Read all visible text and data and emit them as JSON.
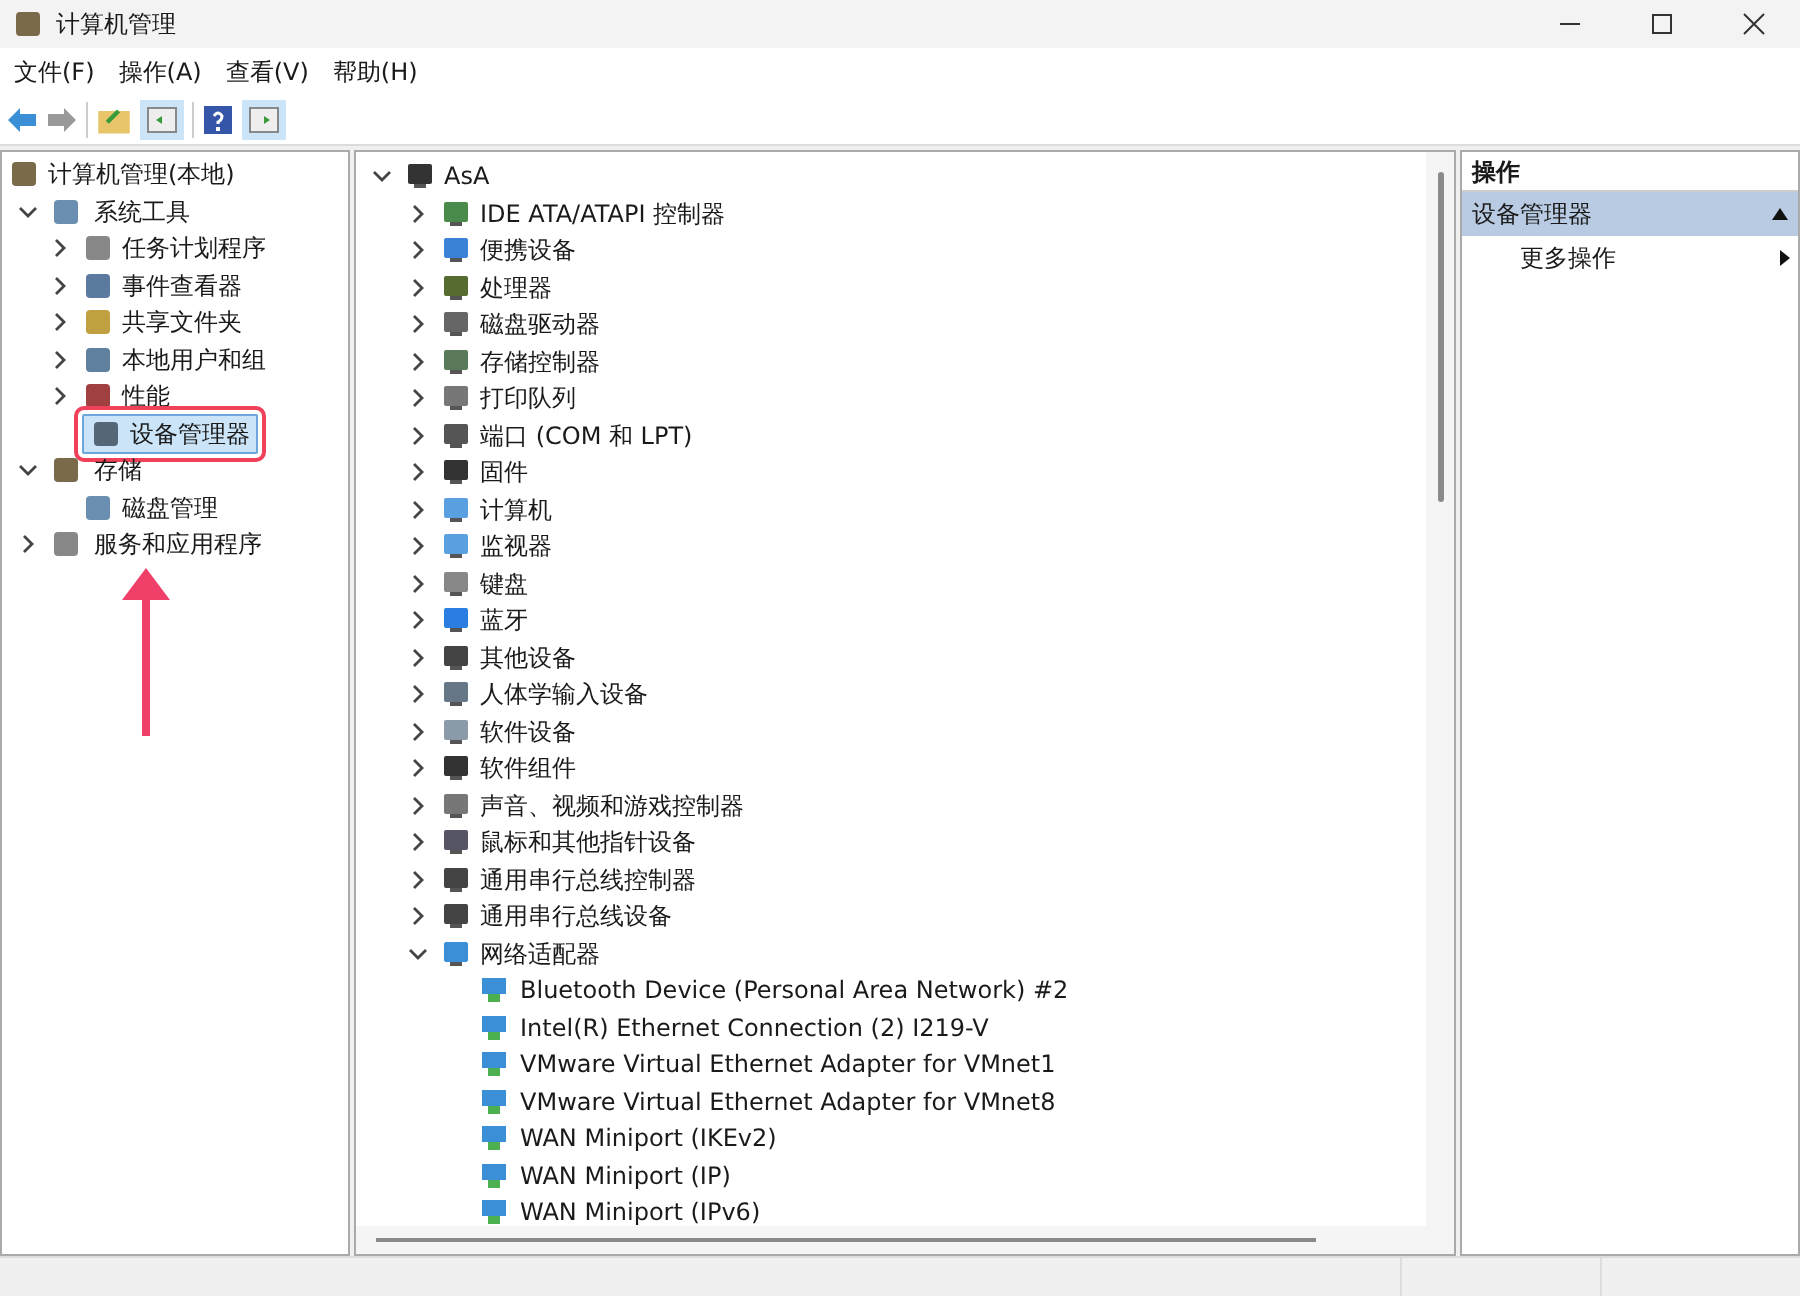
{
  "window": {
    "title": "计算机管理"
  },
  "menu": [
    "文件(F)",
    "操作(A)",
    "查看(V)",
    "帮助(H)"
  ],
  "left_tree": {
    "label": "计算机管理(本地)",
    "children": [
      {
        "label": "系统工具",
        "expanded": true,
        "selected": false,
        "children": [
          {
            "label": "任务计划程序",
            "expanded": false,
            "selected": false
          },
          {
            "label": "事件查看器",
            "expanded": false,
            "selected": false
          },
          {
            "label": "共享文件夹",
            "expanded": false,
            "selected": false
          },
          {
            "label": "本地用户和组",
            "expanded": false,
            "selected": false
          },
          {
            "label": "性能",
            "expanded": false,
            "selected": false
          },
          {
            "label": "设备管理器",
            "selected": true
          }
        ]
      },
      {
        "label": "存储",
        "expanded": true,
        "selected": false,
        "children": [
          {
            "label": "磁盘管理",
            "selected": false
          }
        ]
      },
      {
        "label": "服务和应用程序",
        "expanded": false,
        "selected": false
      }
    ]
  },
  "device_tree": {
    "label": "AsA",
    "expanded": true,
    "children": [
      {
        "label": "IDE ATA/ATAPI 控制器",
        "expanded": false
      },
      {
        "label": "便携设备",
        "expanded": false
      },
      {
        "label": "处理器",
        "expanded": false
      },
      {
        "label": "磁盘驱动器",
        "expanded": false
      },
      {
        "label": "存储控制器",
        "expanded": false
      },
      {
        "label": "打印队列",
        "expanded": false
      },
      {
        "label": "端口 (COM 和 LPT)",
        "expanded": false
      },
      {
        "label": "固件",
        "expanded": false
      },
      {
        "label": "计算机",
        "expanded": false
      },
      {
        "label": "监视器",
        "expanded": false
      },
      {
        "label": "键盘",
        "expanded": false
      },
      {
        "label": "蓝牙",
        "expanded": false
      },
      {
        "label": "其他设备",
        "expanded": false
      },
      {
        "label": "人体学输入设备",
        "expanded": false
      },
      {
        "label": "软件设备",
        "expanded": false
      },
      {
        "label": "软件组件",
        "expanded": false
      },
      {
        "label": "声音、视频和游戏控制器",
        "expanded": false
      },
      {
        "label": "鼠标和其他指针设备",
        "expanded": false
      },
      {
        "label": "通用串行总线控制器",
        "expanded": false
      },
      {
        "label": "通用串行总线设备",
        "expanded": false
      },
      {
        "label": "网络适配器",
        "expanded": true,
        "children": [
          {
            "label": "Bluetooth Device (Personal Area Network) #2"
          },
          {
            "label": "Intel(R) Ethernet Connection (2) I219-V"
          },
          {
            "label": "VMware Virtual Ethernet Adapter for VMnet1"
          },
          {
            "label": "VMware Virtual Ethernet Adapter for VMnet8"
          },
          {
            "label": "WAN Miniport (IKEv2)"
          },
          {
            "label": "WAN Miniport (IP)"
          },
          {
            "label": "WAN Miniport (IPv6)"
          }
        ]
      }
    ]
  },
  "actions": {
    "header": "操作",
    "section": {
      "label": "设备管理器",
      "expanded": true
    },
    "items": [
      "更多操作"
    ]
  }
}
